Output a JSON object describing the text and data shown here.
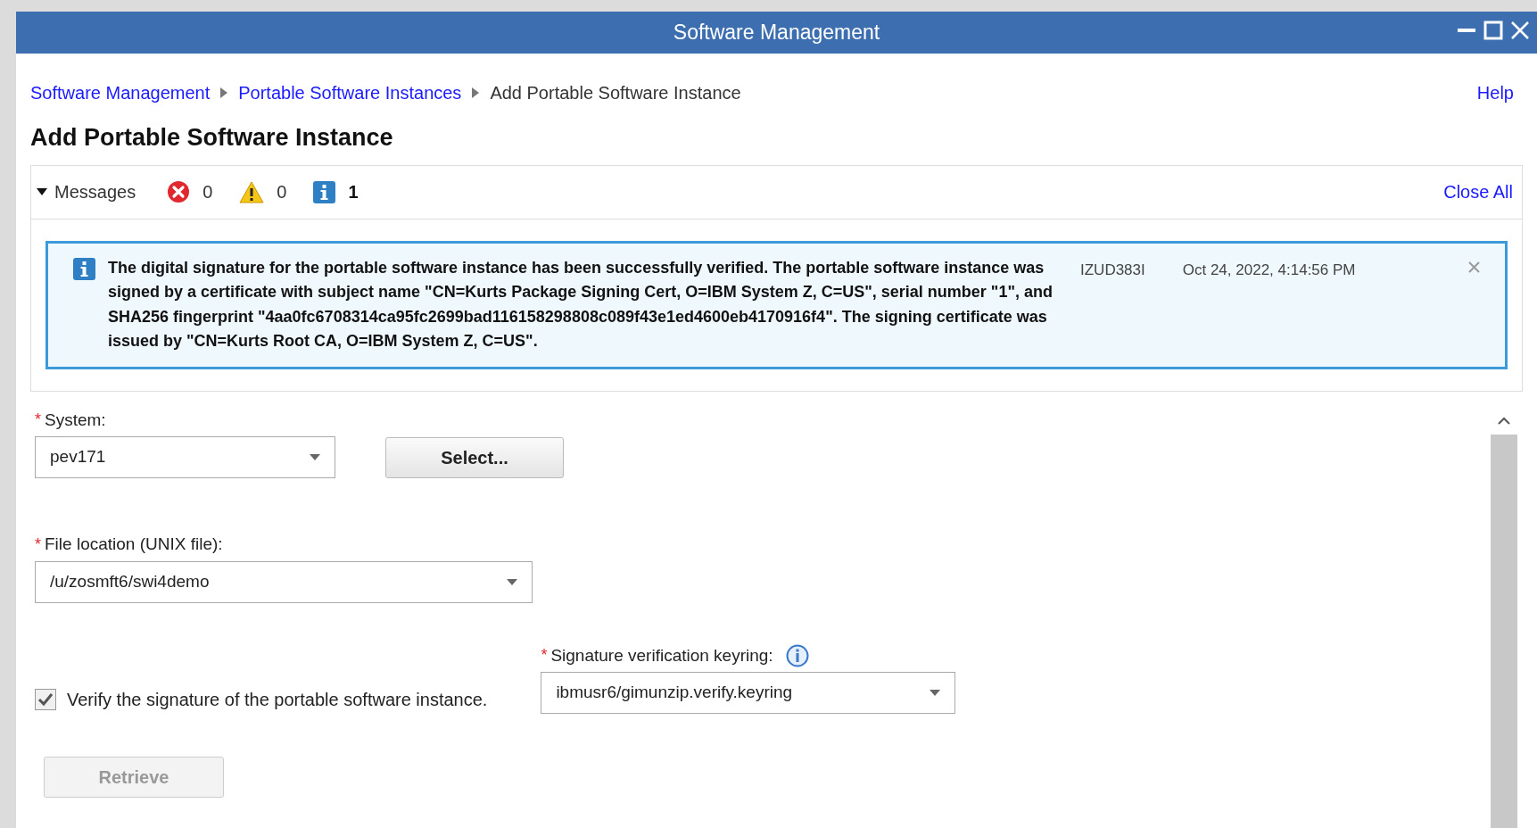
{
  "window": {
    "title": "Software Management"
  },
  "breadcrumb": [
    {
      "label": "Software Management",
      "kind": "link"
    },
    {
      "label": "Portable Software Instances",
      "kind": "link"
    },
    {
      "label": "Add Portable Software Instance",
      "kind": "current"
    }
  ],
  "help": "Help",
  "heading": "Add Portable Software Instance",
  "messages": {
    "label": "Messages",
    "expanded": true,
    "close_all": "Close All",
    "counts": [
      {
        "kind": "error",
        "count": "0"
      },
      {
        "kind": "warning",
        "count": "0"
      },
      {
        "kind": "info",
        "count": "1"
      }
    ],
    "items": [
      {
        "kind": "info",
        "text": "The digital signature for the portable software instance has been successfully verified. The portable software instance was signed by a certificate with subject name \"CN=Kurts Package Signing Cert, O=IBM System Z, C=US\", serial number \"1\", and SHA256 fingerprint \"4aa0fc6708314ca95fc2699bad116158298808c089f43e1ed4600eb4170916f4\". The signing certificate was issued by \"CN=Kurts Root CA, O=IBM System Z, C=US\".",
        "code": "IZUD383I",
        "time": "Oct 24, 2022, 4:14:56 PM"
      }
    ]
  },
  "form": {
    "system": {
      "label": "System:",
      "required_mark": "*",
      "value": "pev171"
    },
    "select_button": {
      "label": "Select..."
    },
    "file_location": {
      "label": "File location (UNIX file):",
      "required_mark": "*",
      "value": "/u/zosmft6/swi4demo"
    },
    "verify": {
      "label": "Verify the signature of the portable software instance.",
      "checked": true
    },
    "keyring": {
      "label": "Signature verification keyring:",
      "required_mark": "*",
      "value": "ibmusr6/gimunzip.verify.keyring"
    },
    "retrieve_button": {
      "label": "Retrieve",
      "disabled": true
    }
  }
}
